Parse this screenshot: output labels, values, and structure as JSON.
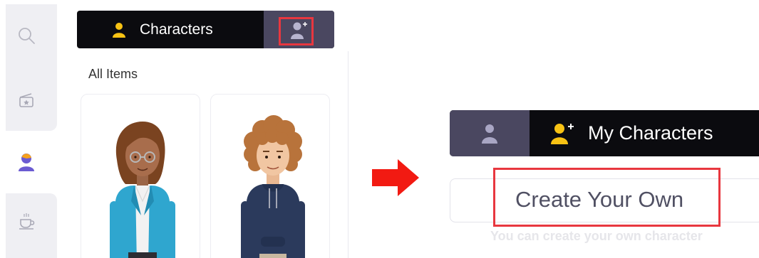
{
  "left_panel": {
    "rail_icons": [
      "search-icon",
      "scene-icon",
      "character-icon",
      "coffee-icon"
    ],
    "header": {
      "tab_label": "Characters",
      "tab_icon": "person-icon",
      "add_button_icon": "add-person-icon"
    },
    "section_label": "All Items",
    "cards": [
      {
        "name": "character-card",
        "icon": "woman-character"
      },
      {
        "name": "character-card",
        "icon": "man-character"
      }
    ]
  },
  "arrow_icon": "right-arrow-icon",
  "right_panel": {
    "header": {
      "person_tab_icon": "person-icon",
      "tab_label": "My Characters",
      "tab_icon": "add-person-icon"
    },
    "create_button_label": "Create Your Own",
    "create_hint": "You can create your own character"
  },
  "colors": {
    "header_bg": "#0b0b0f",
    "tab_active_bg": "#4a4760",
    "accent_yellow": "#f7c214",
    "accent_purple": "#6b5bd2",
    "highlight_red": "#e8373f",
    "arrow_red": "#f21a12",
    "rail_bg": "#efeff3"
  }
}
